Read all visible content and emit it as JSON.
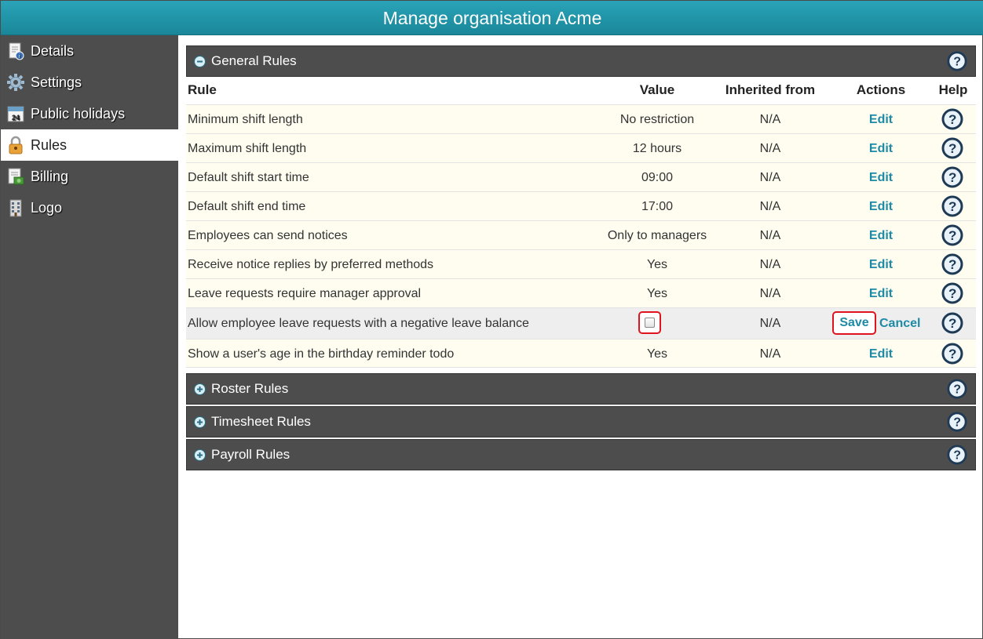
{
  "window": {
    "title": "Manage organisation Acme"
  },
  "sidebar": {
    "items": [
      {
        "label": "Details",
        "icon": "details-icon"
      },
      {
        "label": "Settings",
        "icon": "gear-icon"
      },
      {
        "label": "Public holidays",
        "icon": "calendar-icon"
      },
      {
        "label": "Rules",
        "icon": "lock-icon",
        "active": true
      },
      {
        "label": "Billing",
        "icon": "billing-icon"
      },
      {
        "label": "Logo",
        "icon": "building-icon"
      }
    ]
  },
  "sections": {
    "general": {
      "title": "General Rules",
      "state": "expanded"
    },
    "roster": {
      "title": "Roster Rules",
      "state": "collapsed"
    },
    "timesheet": {
      "title": "Timesheet Rules",
      "state": "collapsed"
    },
    "payroll": {
      "title": "Payroll Rules",
      "state": "collapsed"
    }
  },
  "table": {
    "headers": {
      "rule": "Rule",
      "value": "Value",
      "inherited": "Inherited from",
      "actions": "Actions",
      "help": "Help"
    },
    "rows": [
      {
        "rule": "Minimum shift length",
        "value": "No restriction",
        "inherited": "N/A",
        "action": "Edit"
      },
      {
        "rule": "Maximum shift length",
        "value": "12 hours",
        "inherited": "N/A",
        "action": "Edit"
      },
      {
        "rule": "Default shift start time",
        "value": "09:00",
        "inherited": "N/A",
        "action": "Edit"
      },
      {
        "rule": "Default shift end time",
        "value": "17:00",
        "inherited": "N/A",
        "action": "Edit"
      },
      {
        "rule": "Employees can send notices",
        "value": "Only to managers",
        "inherited": "N/A",
        "action": "Edit"
      },
      {
        "rule": "Receive notice replies by preferred methods",
        "value": "Yes",
        "inherited": "N/A",
        "action": "Edit"
      },
      {
        "rule": "Leave requests require manager approval",
        "value": "Yes",
        "inherited": "N/A",
        "action": "Edit"
      },
      {
        "rule": "Allow employee leave requests with a negative leave balance",
        "checked": false,
        "inherited": "N/A",
        "save": "Save",
        "cancel": "Cancel"
      },
      {
        "rule": "Show a user's age in the birthday reminder todo",
        "value": "Yes",
        "inherited": "N/A",
        "action": "Edit"
      }
    ]
  },
  "colors": {
    "header": "#1a8799",
    "sidebar": "#4d4d4d",
    "link": "#1d8aa6",
    "highlight": "#e0141e"
  }
}
